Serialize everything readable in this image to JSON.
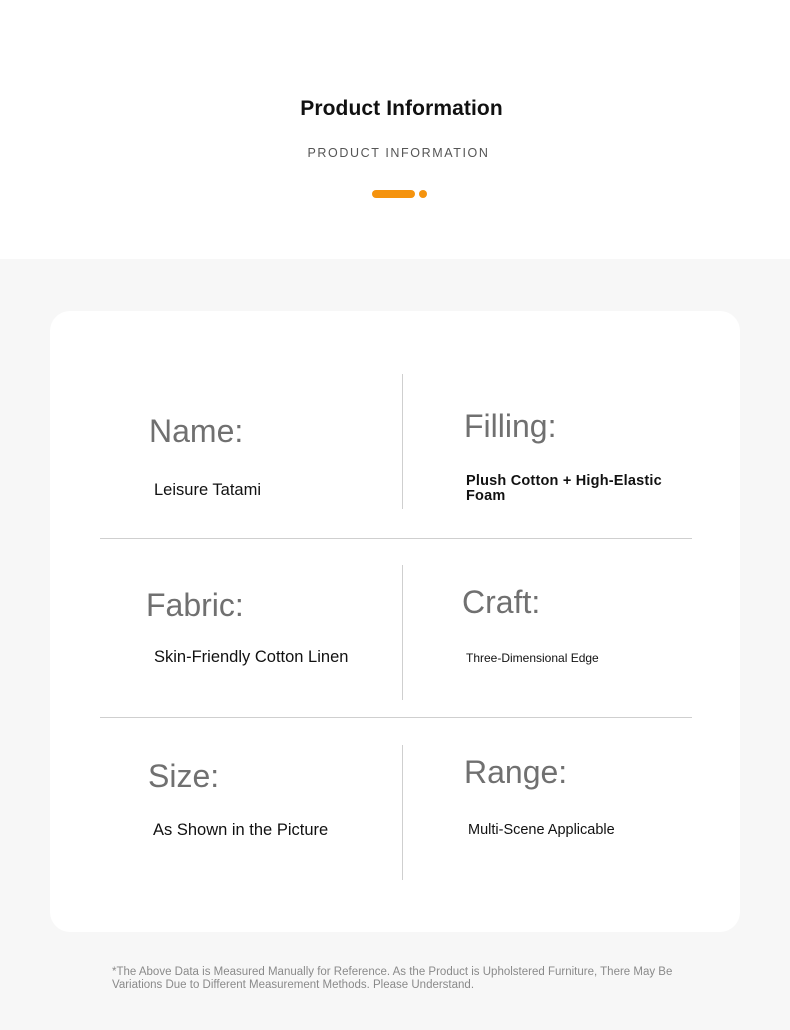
{
  "header": {
    "title": "Product Information",
    "subtitle": "PRODUCT INFORMATION"
  },
  "colors": {
    "accent": "#F5930E",
    "label_gray": "#707070",
    "section_bg": "#F7F7F7"
  },
  "specs": {
    "name": {
      "label": "Name:",
      "value": "Leisure Tatami"
    },
    "filling": {
      "label": "Filling:",
      "value": "Plush Cotton + High-Elastic Foam"
    },
    "fabric": {
      "label": "Fabric:",
      "value": "Skin-Friendly Cotton Linen"
    },
    "craft": {
      "label": "Craft:",
      "value": "Three-Dimensional Edge"
    },
    "size": {
      "label": "Size:",
      "value": "As Shown in the Picture"
    },
    "range": {
      "label": "Range:",
      "value": "Multi-Scene Applicable"
    }
  },
  "footnote": "*The Above Data is Measured Manually for Reference. As the Product is Upholstered Furniture, There May Be Variations Due to Different Measurement Methods. Please Understand."
}
